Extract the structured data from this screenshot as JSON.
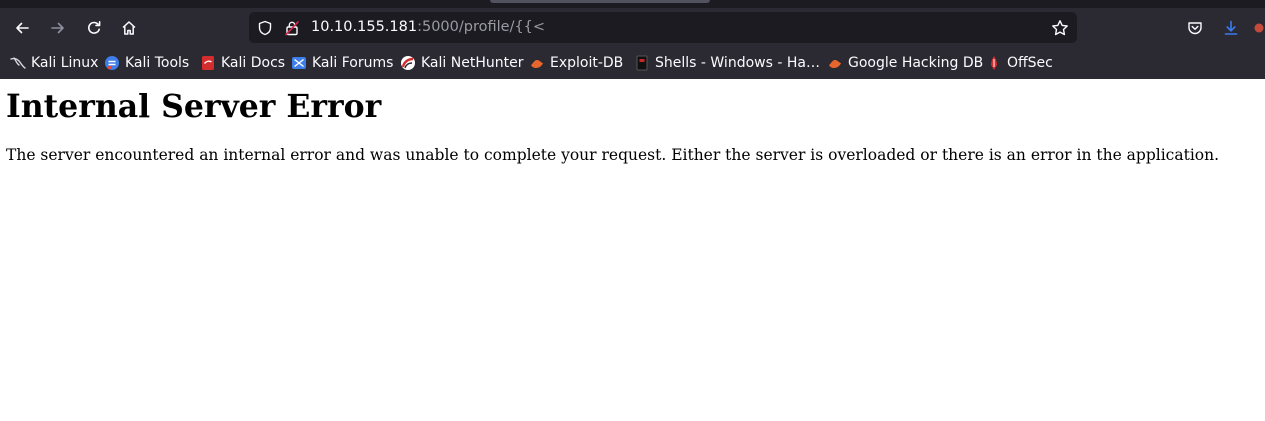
{
  "browser": {
    "url_host": "10.10.155.181",
    "url_path": ":5000/profile/{{<",
    "toolbar": {
      "back": "back-arrow-icon",
      "forward": "forward-arrow-icon",
      "reload": "reload-icon",
      "home": "home-icon",
      "shield": "shield-icon",
      "lock": "insecure-lock-icon",
      "bookmark_star": "star-icon",
      "pocket": "pocket-icon",
      "downloads": "download-icon"
    },
    "bookmarks": [
      {
        "label": "Kali Linux",
        "icon": "kali-dragon-icon"
      },
      {
        "label": "Kali Tools",
        "icon": "kali-tools-icon"
      },
      {
        "label": "Kali Docs",
        "icon": "kali-docs-icon"
      },
      {
        "label": "Kali Forums",
        "icon": "kali-forums-icon"
      },
      {
        "label": "Kali NetHunter",
        "icon": "nethunter-icon"
      },
      {
        "label": "Exploit-DB",
        "icon": "exploit-db-icon"
      },
      {
        "label": "Shells - Windows - Ha…",
        "icon": "shells-icon"
      },
      {
        "label": "Google Hacking DB",
        "icon": "ghdb-icon"
      },
      {
        "label": "OffSec",
        "icon": "offsec-icon"
      }
    ],
    "colors": {
      "toolbar_bg": "#2b2a33",
      "urlbar_bg": "#1c1b22",
      "text": "#fbfbfe",
      "url_path": "#9a9aa3",
      "download_accent": "#3b7bf0"
    }
  },
  "page": {
    "heading": "Internal Server Error",
    "message": "The server encountered an internal error and was unable to complete your request. Either the server is overloaded or there is an error in the application."
  }
}
